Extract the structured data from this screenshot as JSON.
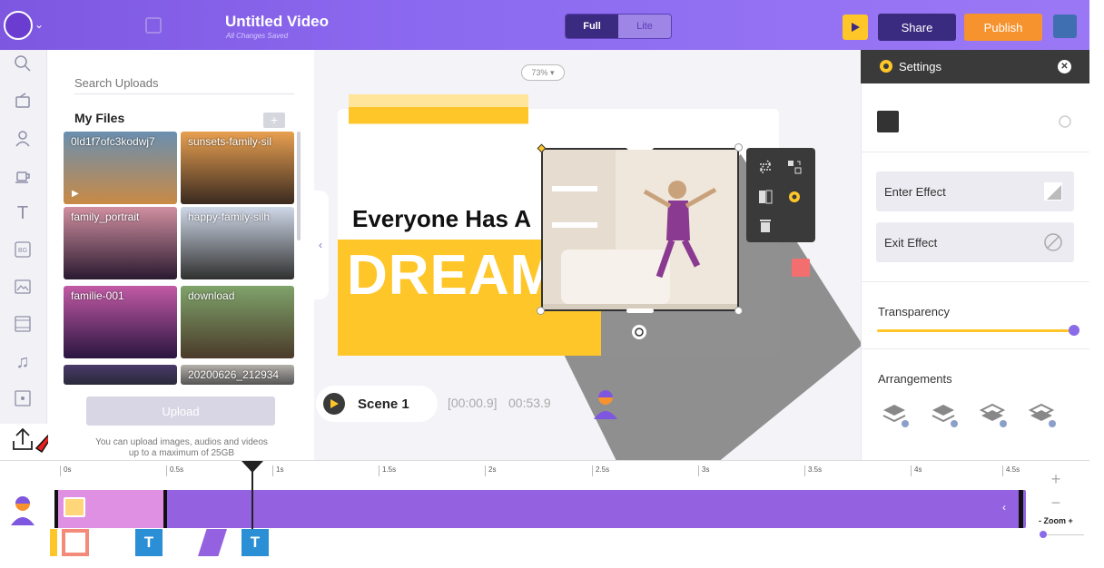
{
  "header": {
    "title": "Untitled Video",
    "subtitle": "All Changes Saved",
    "mode_full": "Full",
    "mode_lite": "Lite",
    "share_label": "Share",
    "publish_label": "Publish",
    "accent_color": "#8c6af0",
    "publish_color": "#f7932f"
  },
  "rail": {
    "items": [
      "search-icon",
      "props-icon",
      "character-icon",
      "cup-icon",
      "text-icon",
      "bg-icon",
      "image-icon",
      "video-icon",
      "music-icon",
      "effects-icon",
      "upload-icon"
    ],
    "bg_text": "BG"
  },
  "uploads": {
    "search_placeholder": "Search Uploads",
    "section_title": "My Files",
    "files": [
      {
        "name": "0ld1f7ofc3kodwj7",
        "colors": [
          "#6a8fb0",
          "#c98a45"
        ]
      },
      {
        "name": "sunsets-family-sil",
        "colors": [
          "#e8a050",
          "#3a2a20"
        ]
      },
      {
        "name": "family_portrait",
        "colors": [
          "#d08fa0",
          "#2a1a30"
        ]
      },
      {
        "name": "happy-family-silh",
        "colors": [
          "#cfd8e8",
          "#30302f"
        ]
      },
      {
        "name": "familie-001",
        "colors": [
          "#c25aa5",
          "#2a1540"
        ]
      },
      {
        "name": "download",
        "colors": [
          "#7fa36a",
          "#4a3a2a"
        ]
      },
      {
        "name": "",
        "colors": [
          "#4a3a6a",
          "#2a2a3a"
        ]
      },
      {
        "name": "20200626_212934",
        "colors": [
          "#b5b0aa",
          "#555"
        ]
      }
    ],
    "upload_label": "Upload",
    "note": "You can upload images, audios and videos up to a maximum of 25GB"
  },
  "canvas": {
    "zoom": "73%",
    "headline": "Everyone Has A",
    "dream": "DREAM"
  },
  "scene": {
    "name": "Scene 1",
    "time_current": "[00:00.9]",
    "time_total": "00:53.9"
  },
  "settings": {
    "title": "Settings",
    "enter_effect": "Enter Effect",
    "exit_effect": "Exit Effect",
    "transparency_label": "Transparency",
    "transparency_value": 1.0,
    "arrangements_label": "Arrangements"
  },
  "timeline": {
    "ticks": [
      "0s",
      "0.5s",
      "1s",
      "1.5s",
      "2s",
      "2.5s",
      "3s",
      "3.5s",
      "4s",
      "4.5s"
    ],
    "zoom_label": "- Zoom +",
    "t_label": "T"
  }
}
